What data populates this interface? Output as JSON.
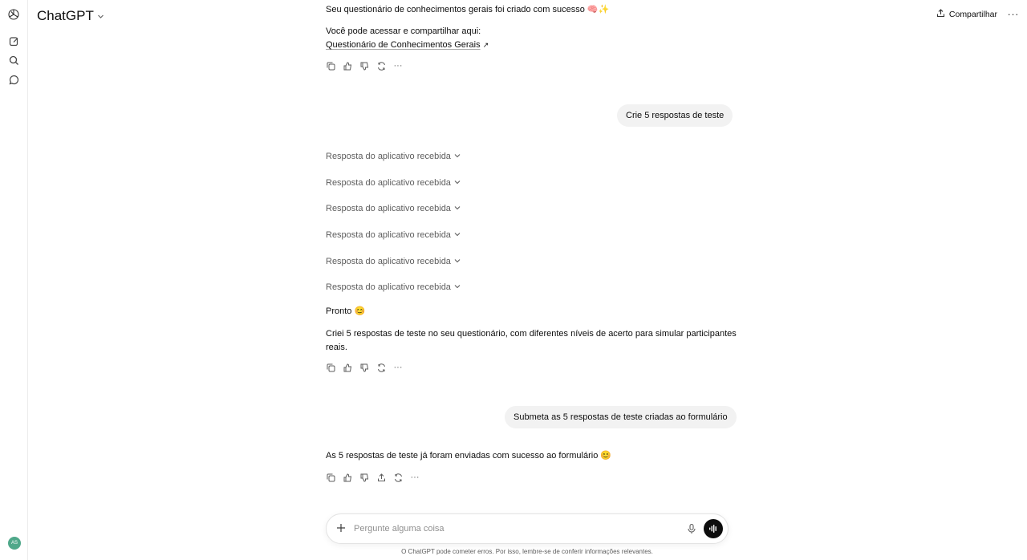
{
  "header": {
    "title": "ChatGPT",
    "share_label": "Compartilhar"
  },
  "sidebar": {
    "avatar_initials": "AS"
  },
  "messages": {
    "m1_line1": "Seu questionário de conhecimentos gerais foi criado com sucesso 🧠✨",
    "m1_line2": "Você pode acessar e compartilhar aqui:",
    "m1_link": "Questionário de Conhecimentos Gerais",
    "user1": "Crie 5 respostas de teste",
    "tool_label": "Resposta do aplicativo recebida",
    "m2_line1": "Pronto 😊",
    "m2_line2": "Criei 5 respostas de teste no seu questionário, com diferentes níveis de acerto para simular participantes",
    "m2_line3": "reais.",
    "user2": "Submeta as 5 respostas de teste criadas ao formulário",
    "m3_line1": "As 5 respostas de teste já foram enviadas com sucesso ao formulário 😊"
  },
  "composer": {
    "placeholder": "Pergunte alguma coisa"
  },
  "footer": {
    "disclaimer": "O ChatGPT pode cometer erros. Por isso, lembre-se de conferir informações relevantes."
  },
  "icons": {
    "logo": "openai-logo-icon",
    "new_chat": "edit-icon",
    "search": "search-icon",
    "chats": "chat-bubble-icon",
    "copy": "copy-icon",
    "like": "thumbs-up-icon",
    "dislike": "thumbs-down-icon",
    "regenerate": "refresh-icon",
    "more": "more-icon",
    "share": "share-icon",
    "plus": "plus-icon",
    "mic": "mic-icon",
    "voice": "voice-mode-icon"
  }
}
